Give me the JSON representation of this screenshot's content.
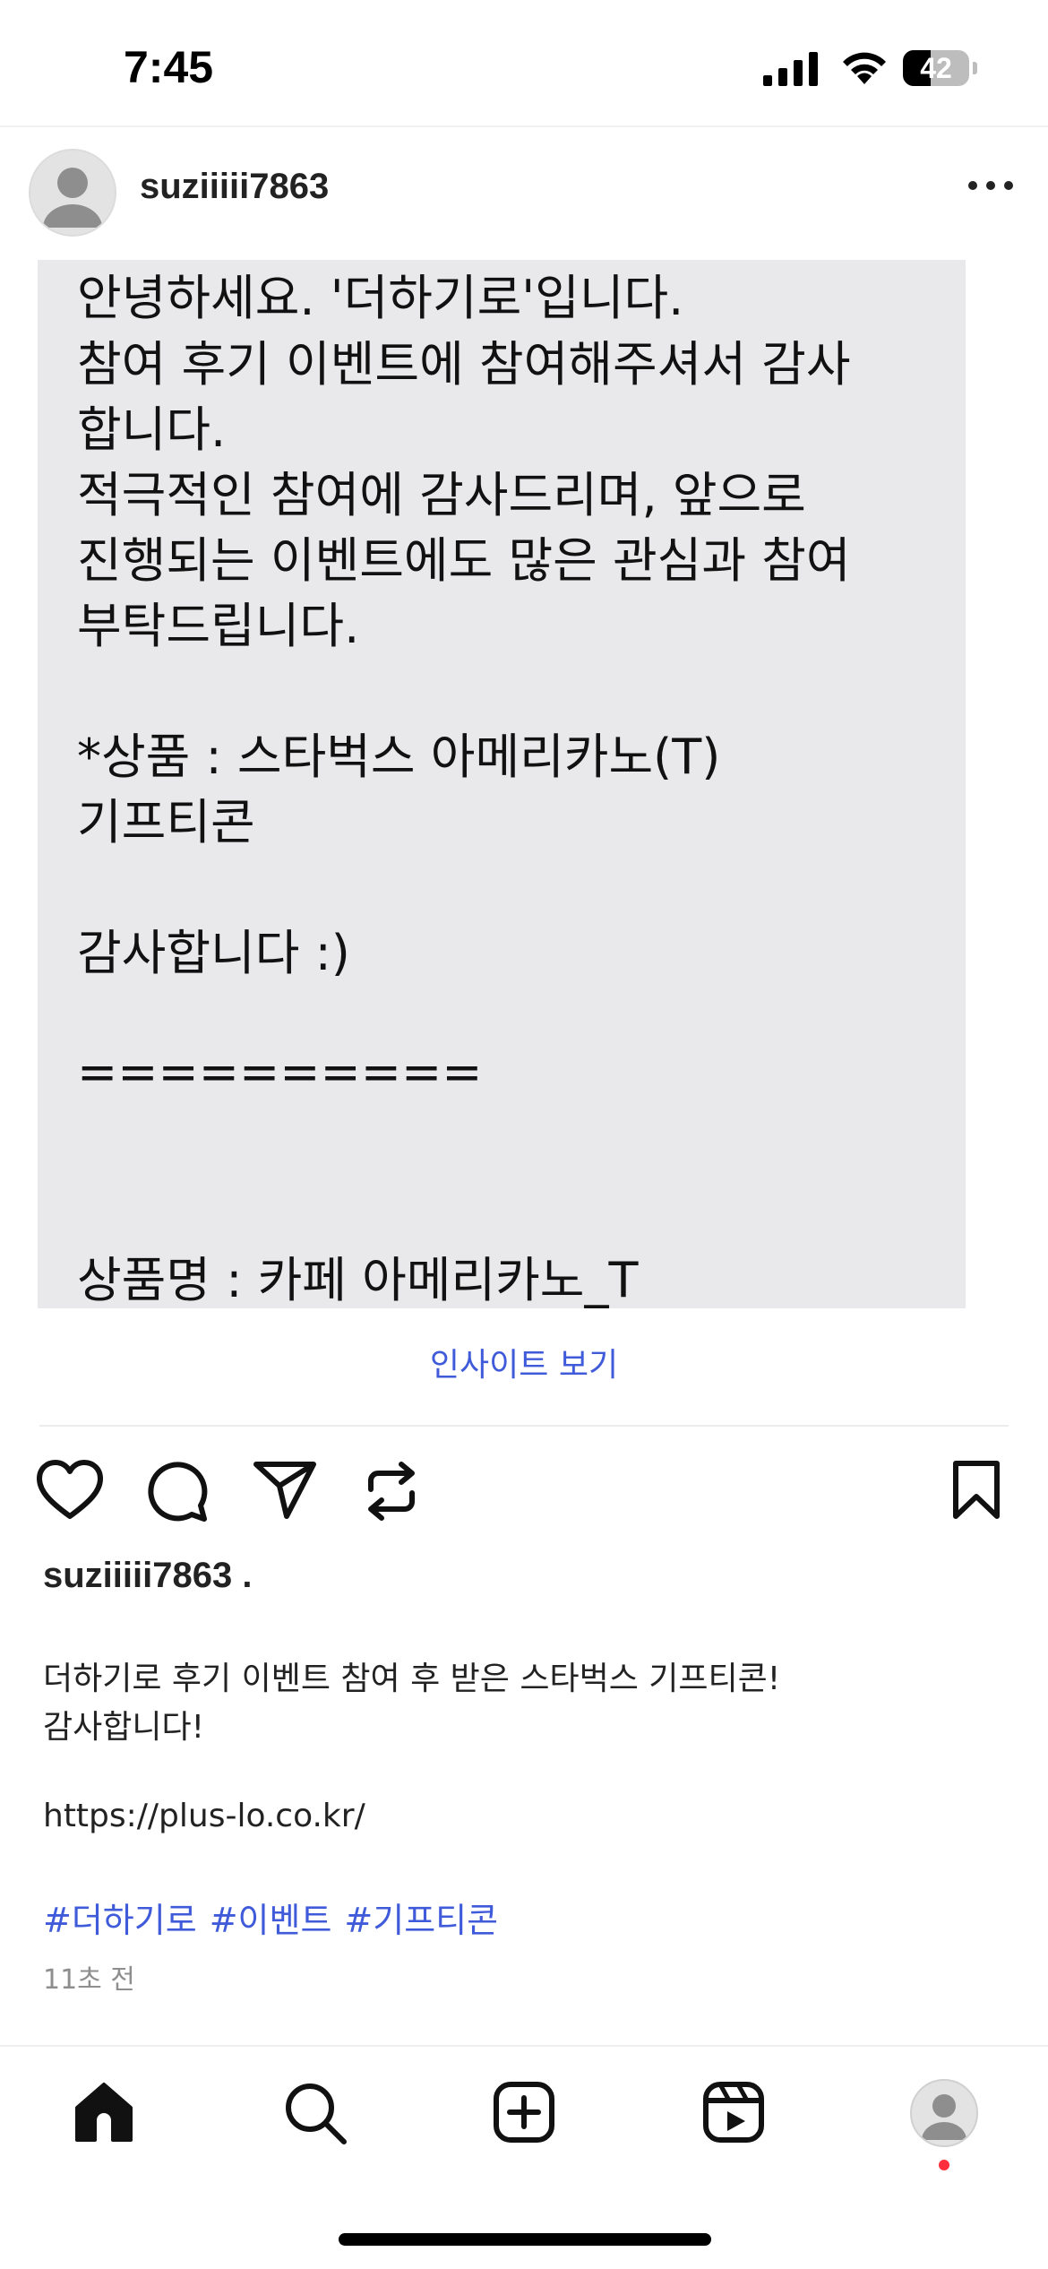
{
  "status_bar": {
    "time": "7:45",
    "battery_level": "42",
    "icons": [
      "signal-icon",
      "wifi-icon",
      "battery-icon"
    ]
  },
  "post": {
    "username": "suziiiii7863",
    "more_icon": "more-horizontal-icon",
    "message_lines": [
      "안녕하세요. '더하기로'입니다.",
      "참여 후기 이벤트에 참여해주셔서 감사",
      "합니다.",
      "적극적인 참여에 감사드리며, 앞으로",
      "진행되는 이벤트에도 많은 관심과 참여",
      "부탁드립니다.",
      "",
      "*상품 : 스타벅스 아메리카노(T)",
      "기프티콘",
      "",
      "감사합니다 :)",
      "",
      "==========",
      "",
      "",
      "상품명 : 카페 아메리카노_T"
    ],
    "insights_label": "인사이트 보기"
  },
  "actions": {
    "icons": [
      "heart-icon",
      "comment-icon",
      "share-icon",
      "repost-icon",
      "bookmark-icon"
    ]
  },
  "caption": {
    "username": "suziiiii7863 .",
    "lines": [
      "더하기로 후기 이벤트 참여 후 받은 스타벅스 기프티콘!",
      "감사합니다!",
      "",
      "https://plus-lo.co.kr/"
    ],
    "hashtags": [
      "#더하기로",
      "#이벤트",
      "#기프티콘"
    ],
    "time_ago": "11초 전"
  },
  "tab_bar": {
    "icons": [
      "home-icon",
      "search-icon",
      "create-post-icon",
      "reels-icon",
      "profile-avatar-icon"
    ],
    "accent_color": "#3f5bd9",
    "notification_dot_color": "#ff2d3d"
  }
}
